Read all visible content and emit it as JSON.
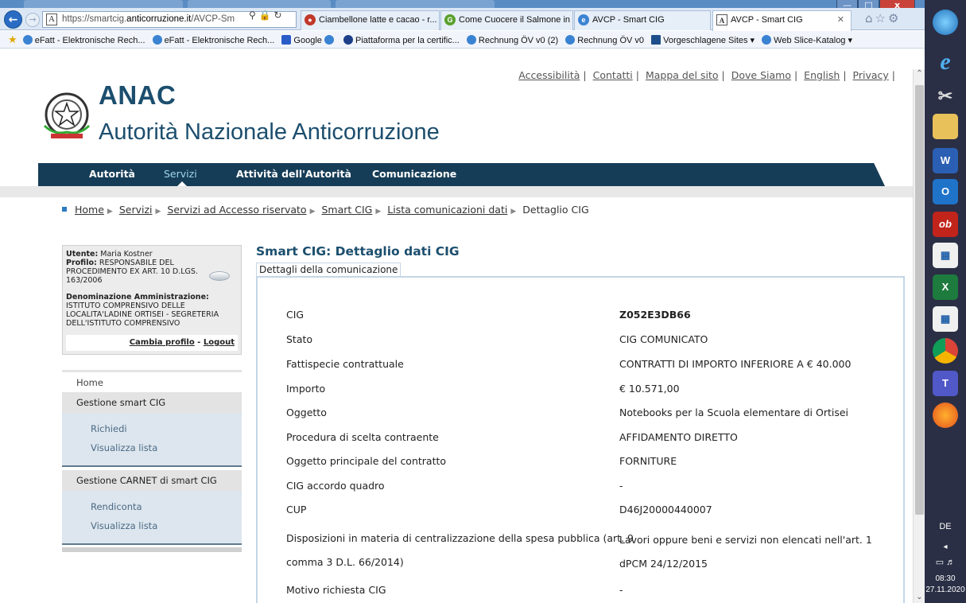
{
  "browser": {
    "url_prefix": "https://smartcig.",
    "url_host": "anticorruzione.it",
    "url_rest": "/AVCP-Sm",
    "tabs": [
      {
        "label": "Ciambellone latte e cacao - r..."
      },
      {
        "label": "Come Cuocere il Salmone in ..."
      },
      {
        "label": "AVCP - Smart CIG"
      },
      {
        "label": "AVCP - Smart CIG"
      }
    ],
    "favorites": [
      "eFatt - Elektronische Rech...",
      "eFatt - Elektronische Rech...",
      "Google",
      "Piattaforma per la certific...",
      "Rechnung ÖV v0 (2)",
      "Rechnung ÖV v0",
      "Vorgeschlagene Sites ▾",
      "Web Slice-Katalog ▾"
    ],
    "window_controls": {
      "min": "—",
      "max": "□",
      "close": "x"
    }
  },
  "top_links": [
    "Accessibilità",
    "Contatti",
    "Mappa del sito",
    "Dove Siamo",
    "English",
    "Privacy"
  ],
  "brand": {
    "name": "ANAC",
    "subtitle": "Autorità Nazionale Anticorruzione"
  },
  "nav": {
    "items": [
      "Autorità",
      "Servizi",
      "Attività dell'Autorità",
      "Comunicazione"
    ]
  },
  "breadcrumb": [
    "Home",
    "Servizi",
    "Servizi ad Accesso riservato",
    "Smart CIG",
    "Lista comunicazioni dati",
    "Dettaglio CIG"
  ],
  "user": {
    "utente_label": "Utente:",
    "utente_value": "Maria Kostner",
    "profilo_label": "Profilo:",
    "profilo_value": "RESPONSABILE DEL PROCEDIMENTO EX ART. 10 D.LGS. 163/2006",
    "denominazione_label": "Denominazione Amministrazione:",
    "denominazione_value": "ISTITUTO COMPRENSIVO DELLE LOCALITA'LADINE ORTISEI - SEGRETERIA DELL'ISTITUTO COMPRENSIVO",
    "change_profile": "Cambia profilo",
    "sep": " - ",
    "logout": "Logout"
  },
  "sidemenu": {
    "home": "Home",
    "group1": "Gestione smart CIG",
    "group1_items": [
      "Richiedi",
      "Visualizza lista"
    ],
    "group2": "Gestione CARNET di smart CIG",
    "group2_items": [
      "Rendiconta",
      "Visualizza lista"
    ]
  },
  "content": {
    "title": "Smart CIG: Dettaglio dati CIG",
    "legend": "Dettagli della comunicazione",
    "rows": [
      {
        "label": "CIG",
        "value": "Z052E3DB66"
      },
      {
        "label": "Stato",
        "value": "CIG COMUNICATO"
      },
      {
        "label": "Fattispecie contrattuale",
        "value": "CONTRATTI DI IMPORTO INFERIORE A € 40.000"
      },
      {
        "label": "Importo",
        "value": "€ 10.571,00"
      },
      {
        "label": "Oggetto",
        "value": "Notebooks per la Scuola elementare di Ortisei"
      },
      {
        "label": "Procedura di scelta contraente",
        "value": "AFFIDAMENTO DIRETTO"
      },
      {
        "label": "Oggetto principale del contratto",
        "value": "FORNITURE"
      },
      {
        "label": "CIG accordo quadro",
        "value": "-"
      },
      {
        "label": "CUP",
        "value": "D46J20000440007"
      },
      {
        "label": "Disposizioni in materia di centralizzazione della spesa pubblica (art. 9",
        "label2": "comma 3 D.L. 66/2014)",
        "value": "Lavori oppure beni e servizi non elencati nell'art. 1",
        "value2": "dPCM 24/12/2015"
      },
      {
        "label": "Motivo richiesta CIG",
        "value": "-"
      }
    ]
  },
  "taskbar": {
    "lang": "DE",
    "time": "08:30",
    "date": "27.11.2020",
    "icons": [
      "W",
      "O",
      "X",
      "T"
    ],
    "obu": "ob"
  }
}
